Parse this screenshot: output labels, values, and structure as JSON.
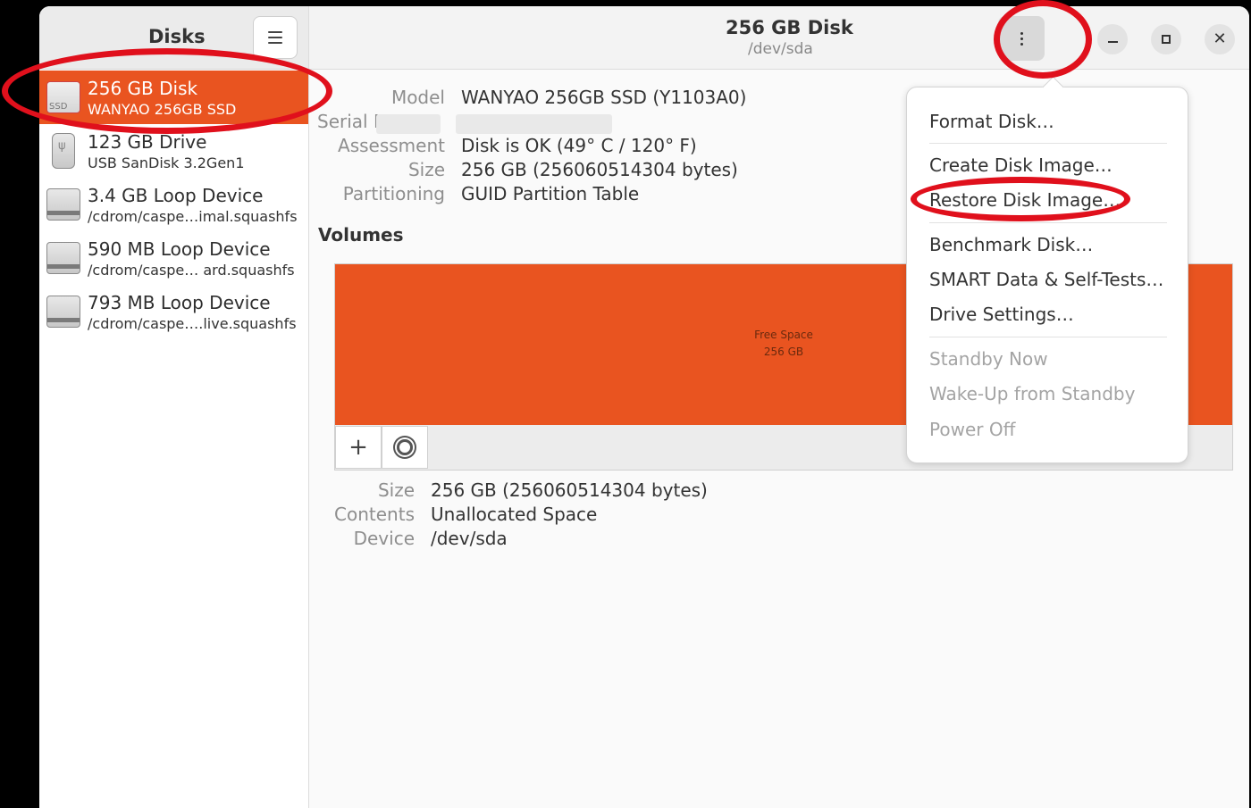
{
  "sidebar": {
    "title": "Disks",
    "devices": [
      {
        "name": "256 GB Disk",
        "sub": "WANYAO 256GB SSD",
        "icon": "ssd-icon",
        "icon_label": "SSD"
      },
      {
        "name": "123 GB Drive",
        "sub": "USB SanDisk 3.2Gen1",
        "icon": "usb-drive-icon",
        "icon_label": "ψ"
      },
      {
        "name": "3.4 GB Loop Device",
        "sub": "/cdrom/caspe…imal.squashfs",
        "icon": "loop-device-icon"
      },
      {
        "name": "590 MB Loop Device",
        "sub": "/cdrom/caspe… ard.squashfs",
        "icon": "loop-device-icon"
      },
      {
        "name": "793 MB Loop Device",
        "sub": "/cdrom/caspe….live.squashfs",
        "icon": "loop-device-icon"
      }
    ]
  },
  "header": {
    "title": "256 GB Disk",
    "subtitle": "/dev/sda",
    "close_glyph": "✕"
  },
  "disk_info": {
    "model_label": "Model",
    "model_value": "WANYAO 256GB SSD (Y1103A0)",
    "serial_label": "Serial N",
    "assessment_label": "Assessment",
    "assessment_value": "Disk is OK (49° C / 120° F)",
    "size_label": "Size",
    "size_value": "256 GB (256060514304 bytes)",
    "partitioning_label": "Partitioning",
    "partitioning_value": "GUID Partition Table"
  },
  "volumes": {
    "heading": "Volumes",
    "segment_label": "Free Space",
    "segment_size": "256 GB",
    "add_glyph": "+",
    "size_label": "Size",
    "size_value": "256 GB (256060514304 bytes)",
    "contents_label": "Contents",
    "contents_value": "Unallocated Space",
    "device_label": "Device",
    "device_value": "/dev/sda"
  },
  "menu": {
    "items": [
      {
        "label": "Format Disk…",
        "enabled": true
      },
      {
        "label": "Create Disk Image…",
        "enabled": true
      },
      {
        "label": "Restore Disk Image…",
        "enabled": true
      },
      {
        "label": "Benchmark Disk…",
        "enabled": true
      },
      {
        "label": "SMART Data & Self-Tests…",
        "enabled": true
      },
      {
        "label": "Drive Settings…",
        "enabled": true
      },
      {
        "label": "Standby Now",
        "enabled": false
      },
      {
        "label": "Wake-Up from Standby",
        "enabled": false
      },
      {
        "label": "Power Off",
        "enabled": false
      }
    ]
  },
  "colors": {
    "accent": "#e95420",
    "annotation": "#e0101c"
  }
}
